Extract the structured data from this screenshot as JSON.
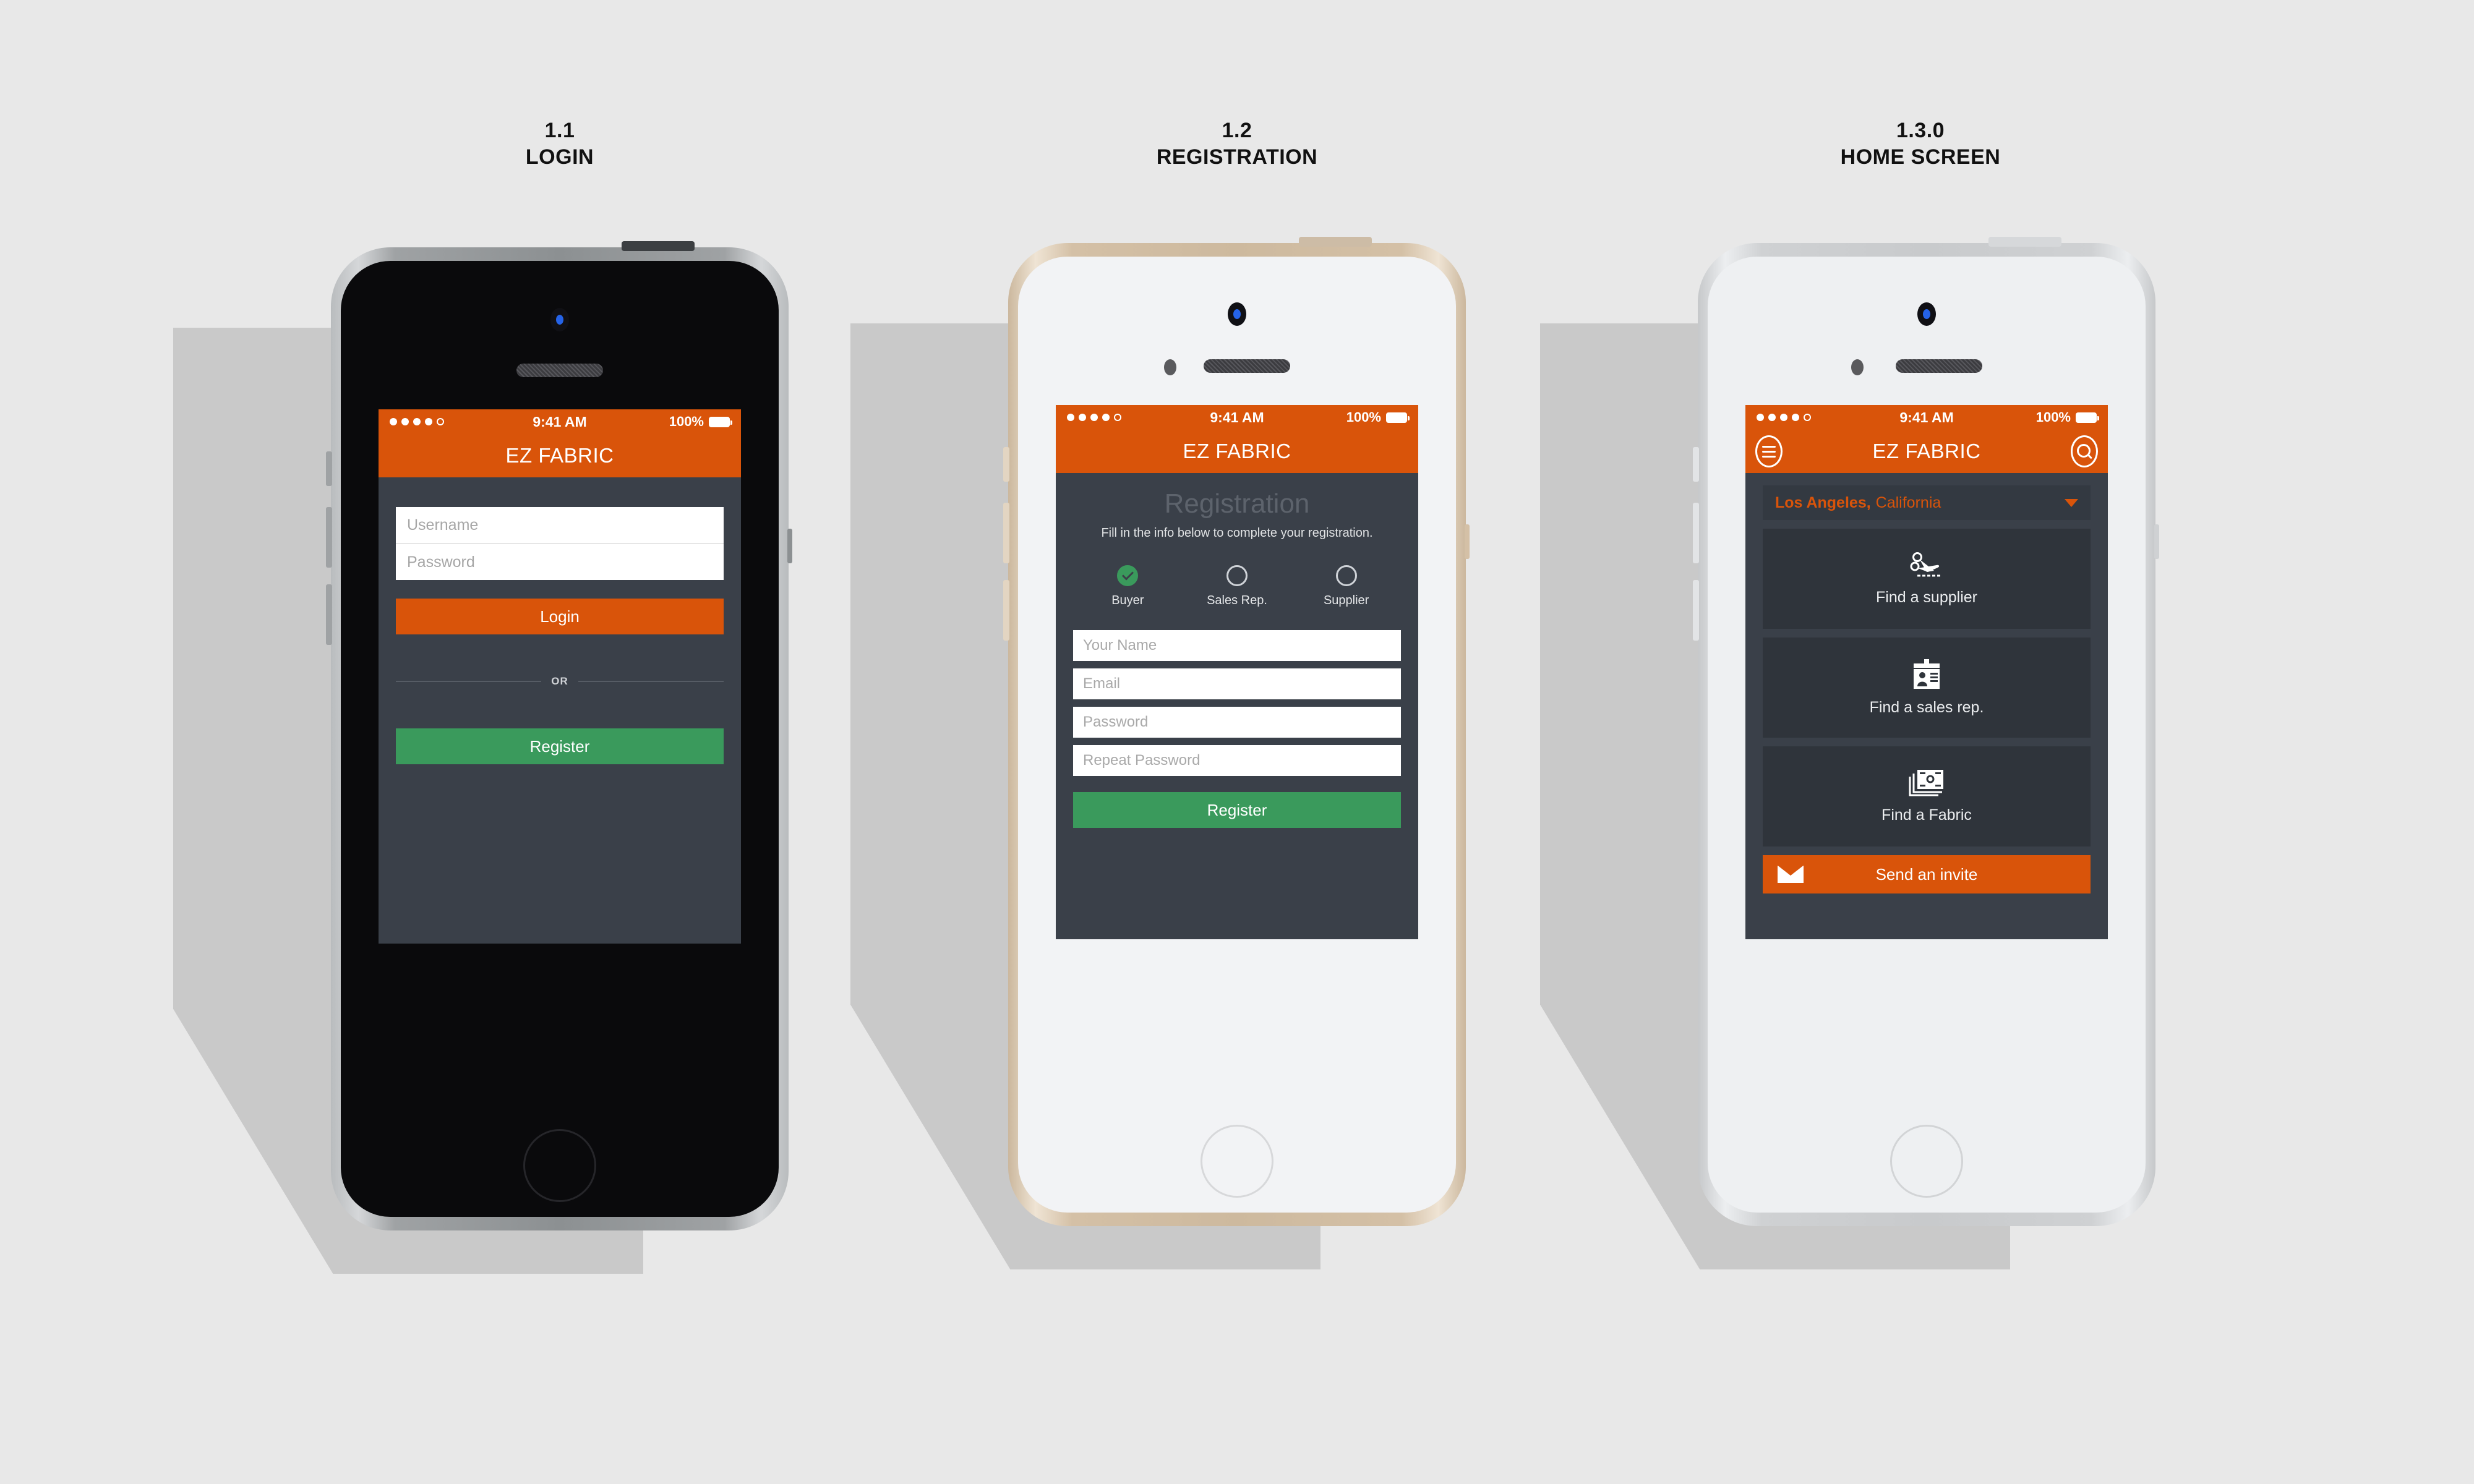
{
  "screens": [
    {
      "caption_number": "1.1",
      "caption_title": "LOGIN",
      "device_color": "black",
      "statusbar": {
        "time": "9:41 AM",
        "battery_percent": "100%",
        "signal_dots_filled": 4,
        "signal_dots_total": 5
      },
      "navbar": {
        "brand": "EZ FABRIC"
      },
      "form": {
        "username_placeholder": "Username",
        "password_placeholder": "Password",
        "login_label": "Login",
        "or_label": "OR",
        "register_label": "Register"
      }
    },
    {
      "caption_number": "1.2",
      "caption_title": "REGISTRATION",
      "device_color": "gold",
      "statusbar": {
        "time": "9:41 AM",
        "battery_percent": "100%",
        "signal_dots_filled": 4,
        "signal_dots_total": 5
      },
      "navbar": {
        "brand": "EZ FABRIC"
      },
      "heading": "Registration",
      "subheading": "Fill in the info below to complete your registration.",
      "roles": [
        {
          "label": "Buyer",
          "selected": true
        },
        {
          "label": "Sales Rep.",
          "selected": false
        },
        {
          "label": "Supplier",
          "selected": false
        }
      ],
      "inputs": [
        {
          "placeholder": "Your Name"
        },
        {
          "placeholder": "Email"
        },
        {
          "placeholder": "Password"
        },
        {
          "placeholder": "Repeat Password"
        }
      ],
      "register_label": "Register"
    },
    {
      "caption_number": "1.3.0",
      "caption_title": "HOME SCREEN",
      "device_color": "silver",
      "statusbar": {
        "time": "9:41 AM",
        "battery_percent": "100%",
        "signal_dots_filled": 4,
        "signal_dots_total": 5
      },
      "navbar": {
        "brand": "EZ FABRIC",
        "menu_icon": "hamburger-icon",
        "search_icon": "search-icon"
      },
      "location": {
        "city": "Los Angeles,",
        "state": "California",
        "caret": "chevron-down-icon"
      },
      "cards": [
        {
          "label": "Find a supplier",
          "icon": "scissors-icon"
        },
        {
          "label": "Find a sales rep.",
          "icon": "id-badge-icon"
        },
        {
          "label": "Find a Fabric",
          "icon": "fabric-swatches-icon"
        }
      ],
      "invite": {
        "label": "Send an invite",
        "icon": "envelope-icon"
      }
    }
  ],
  "colors": {
    "background": "#e8e8e8",
    "accent_orange": "#d9540a",
    "accent_green": "#3a9a5c",
    "screen_dark": "#3a4049",
    "card_dark": "#2f343b",
    "input_white": "#ffffff"
  }
}
